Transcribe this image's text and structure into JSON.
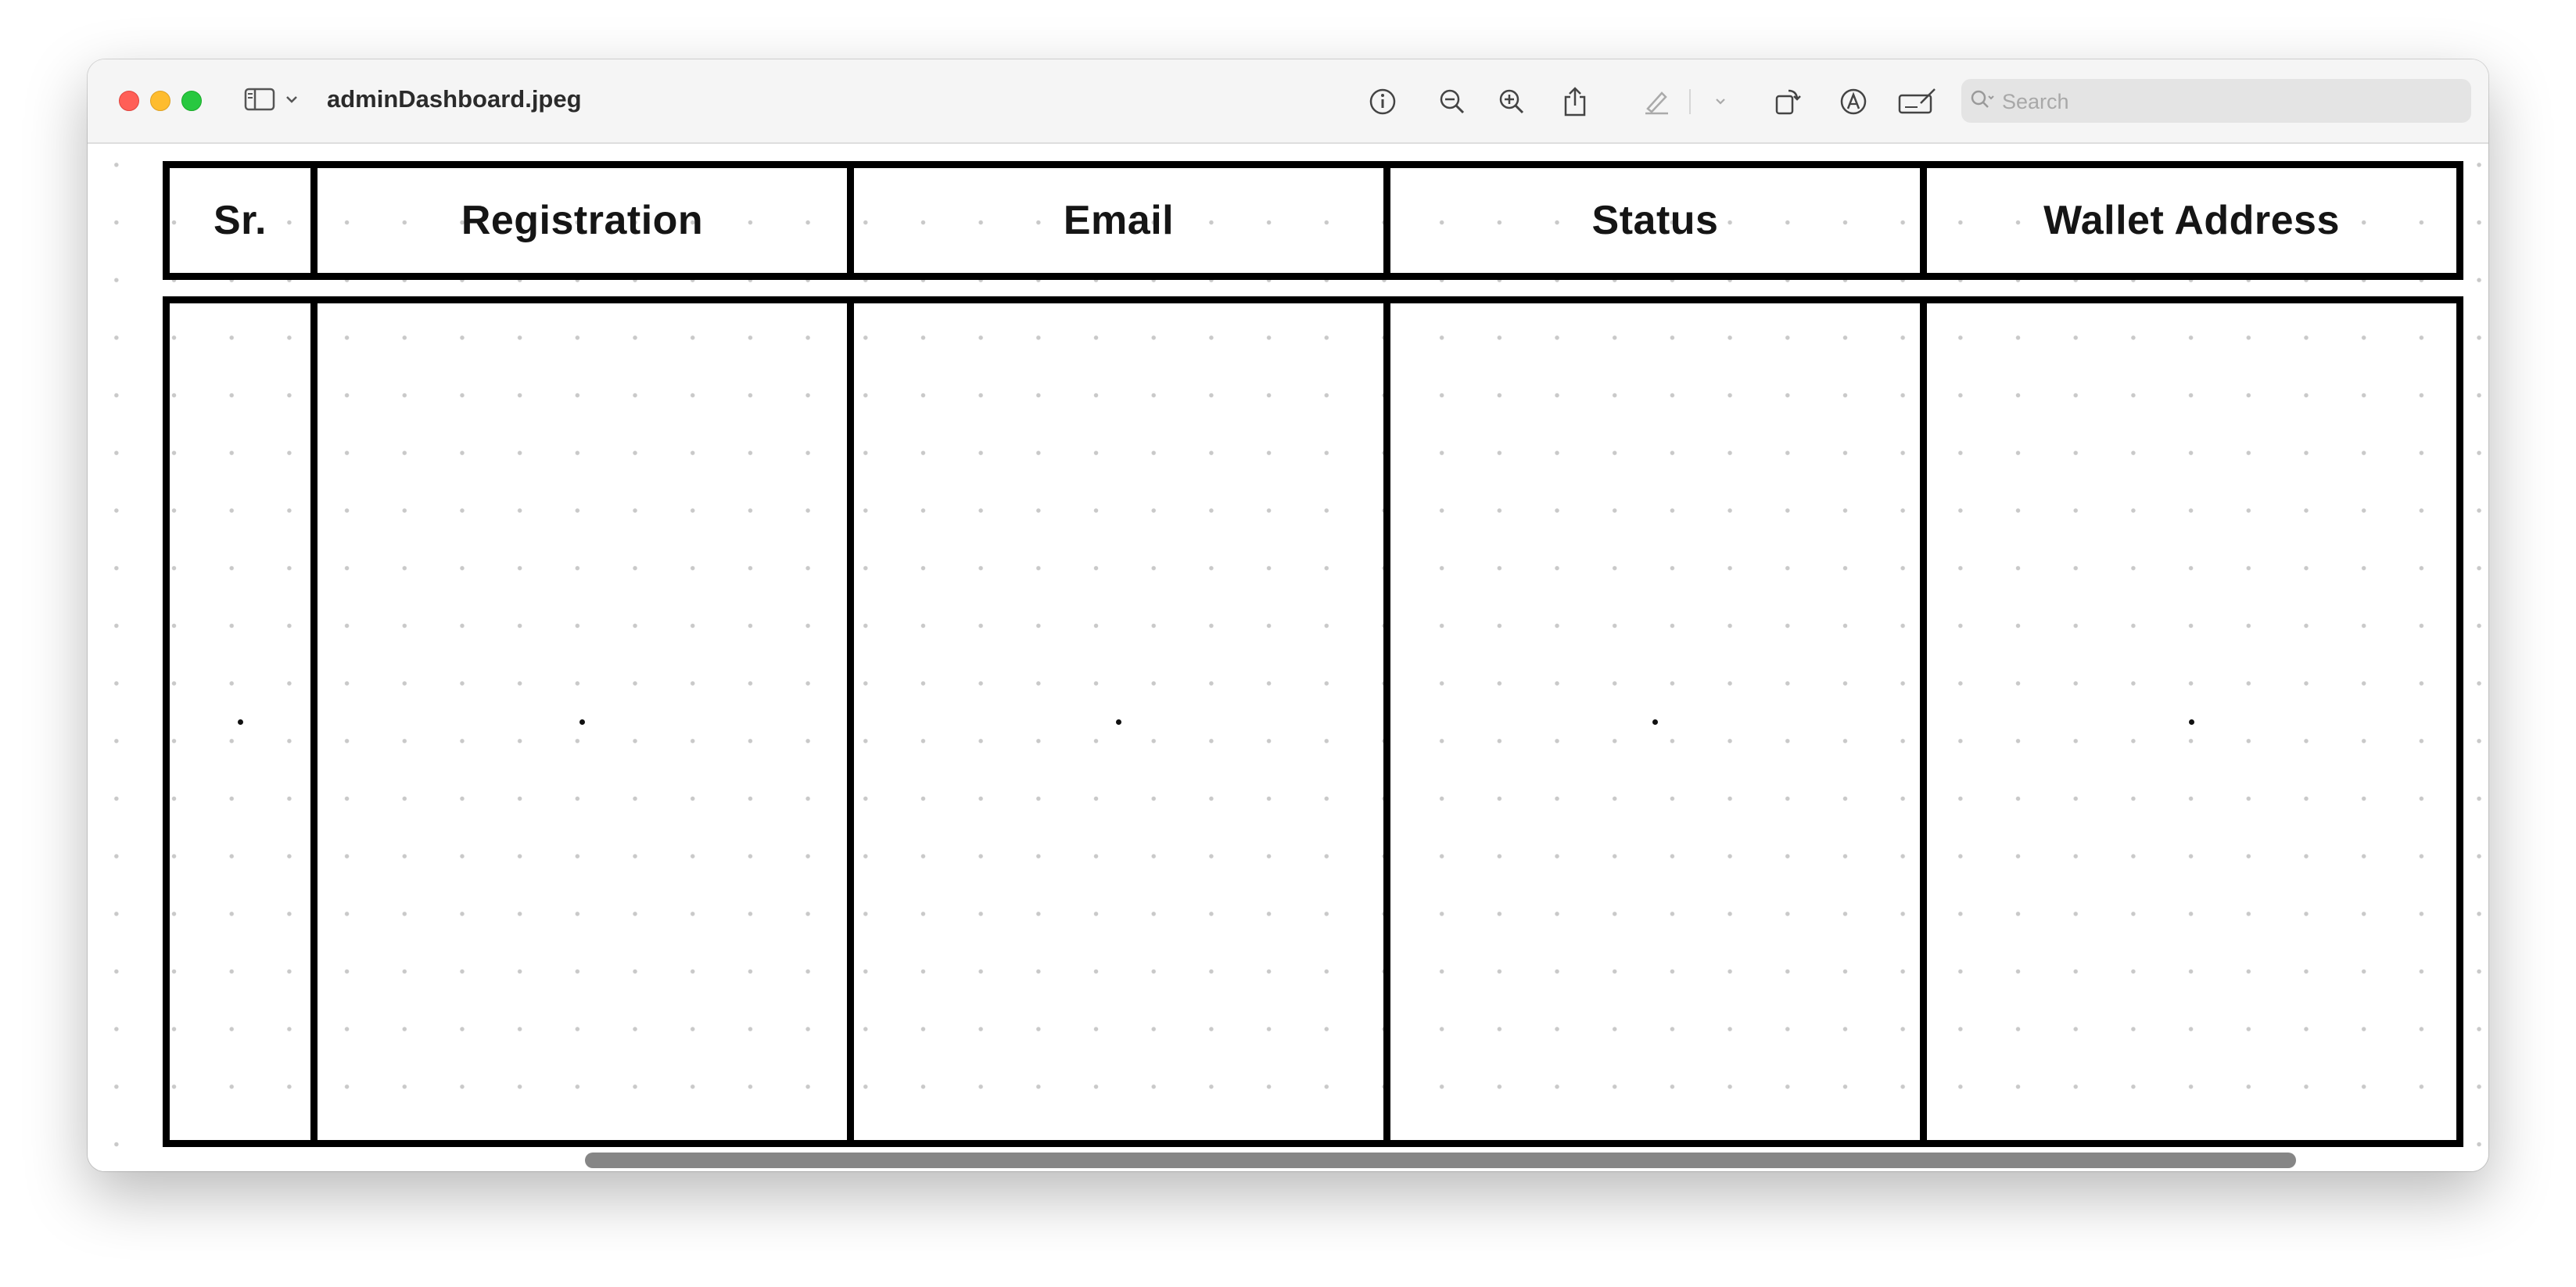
{
  "window": {
    "title": "adminDashboard.jpeg"
  },
  "toolbar": {
    "icons": [
      "sidebar-icon",
      "chevron-down-icon",
      "info-icon",
      "zoom-out-icon",
      "zoom-in-icon",
      "share-icon",
      "highlight-pen-icon",
      "chevron-down-icon",
      "rotate-icon",
      "markup-icon",
      "signature-icon"
    ],
    "search_placeholder": "Search"
  },
  "table": {
    "headers": [
      "Sr.",
      "Registration",
      "Email",
      "Status",
      "Wallet Address"
    ]
  },
  "colors": {
    "close": "#ff5f57",
    "minimize": "#febc2e",
    "maximize": "#28c840",
    "grid_line": "#000000",
    "dot_grid": "#c9c9c9"
  }
}
